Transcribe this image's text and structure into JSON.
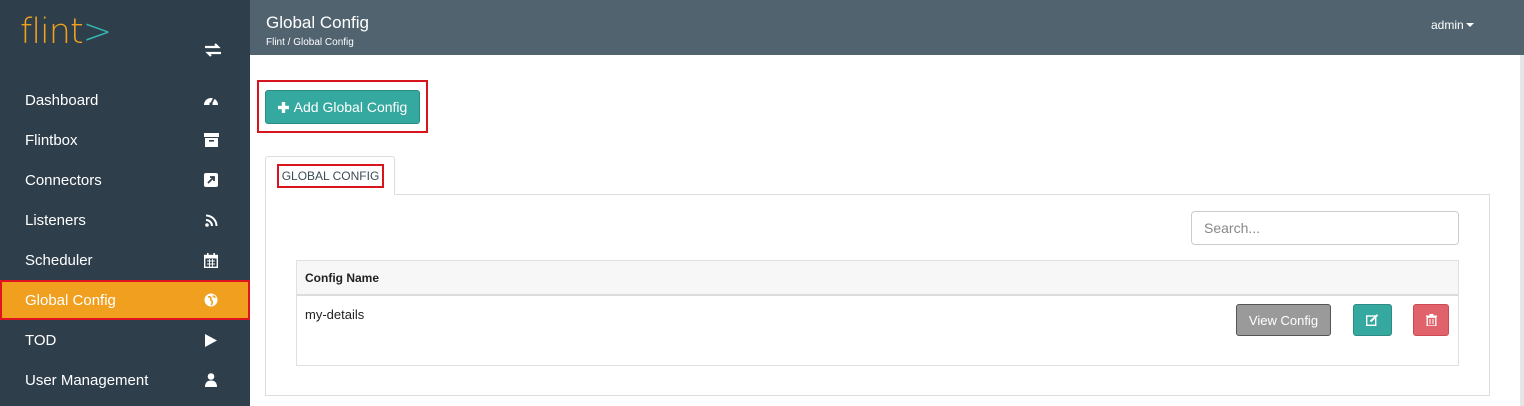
{
  "sidebar": {
    "logo_text": "flint",
    "logo_suffix": ">",
    "toggle_icon": "swap-arrows-icon",
    "items": [
      {
        "label": "Dashboard",
        "icon": "dashboard-icon",
        "active": false
      },
      {
        "label": "Flintbox",
        "icon": "archive-icon",
        "active": false
      },
      {
        "label": "Connectors",
        "icon": "external-link-icon",
        "active": false
      },
      {
        "label": "Listeners",
        "icon": "rss-icon",
        "active": false
      },
      {
        "label": "Scheduler",
        "icon": "calendar-icon",
        "active": false
      },
      {
        "label": "Global Config",
        "icon": "globe-icon",
        "active": true
      },
      {
        "label": "TOD",
        "icon": "play-icon",
        "active": false
      },
      {
        "label": "User Management",
        "icon": "user-icon",
        "active": false
      }
    ]
  },
  "header": {
    "title": "Global Config",
    "breadcrumb": "Flint / Global Config",
    "user": "admin"
  },
  "main": {
    "add_button_label": "Add Global Config",
    "tab_label": "GLOBAL CONFIG",
    "search_placeholder": "Search...",
    "table": {
      "column_header": "Config Name",
      "rows": [
        {
          "name": "my-details",
          "view_label": "View Config"
        }
      ]
    }
  },
  "colors": {
    "sidebar_bg": "#2e3e4b",
    "topbar_bg": "#50636f",
    "accent_orange": "#f0a01e",
    "accent_teal": "#35a89f",
    "danger": "#e0636b",
    "highlight_border": "#d8141e"
  }
}
